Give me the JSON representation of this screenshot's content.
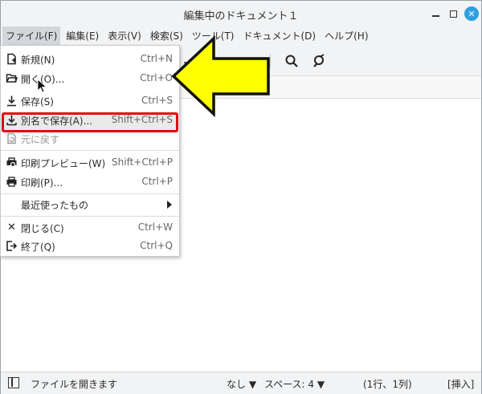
{
  "window": {
    "title": "編集中のドキュメント１"
  },
  "menubar": {
    "items": [
      "ファイル(F)",
      "編集(E)",
      "表示(V)",
      "検索(S)",
      "ツール(T)",
      "ドキュメント(D)",
      "ヘルプ(H)"
    ]
  },
  "file_menu": {
    "new": {
      "label": "新規(N)",
      "shortcut": "Ctrl+N"
    },
    "open": {
      "label": "開く(O)...",
      "shortcut": "Ctrl+O"
    },
    "save": {
      "label": "保存(S)",
      "shortcut": "Ctrl+S"
    },
    "save_as": {
      "label": "別名で保存(A)...",
      "shortcut": "Shift+Ctrl+S"
    },
    "revert": {
      "label": "元に戻す"
    },
    "print_preview": {
      "label": "印刷プレビュー(W)",
      "shortcut": "Shift+Ctrl+P"
    },
    "print": {
      "label": "印刷(P)...",
      "shortcut": "Ctrl+P"
    },
    "recent": {
      "label": "最近使ったもの"
    },
    "close": {
      "label": "閉じる(C)",
      "shortcut": "Ctrl+W"
    },
    "quit": {
      "label": "終了(Q)",
      "shortcut": "Ctrl+Q"
    }
  },
  "statusbar": {
    "message": "ファイルを開きます",
    "syntax": "なし ▼",
    "tab_width": "スペース: 4 ▼",
    "position": "(1行、1列)",
    "mode": "[挿入]"
  },
  "colors": {
    "highlight_border": "#e30613",
    "arrow_fill": "#ffff00",
    "close_button": "#2e9fe0"
  }
}
